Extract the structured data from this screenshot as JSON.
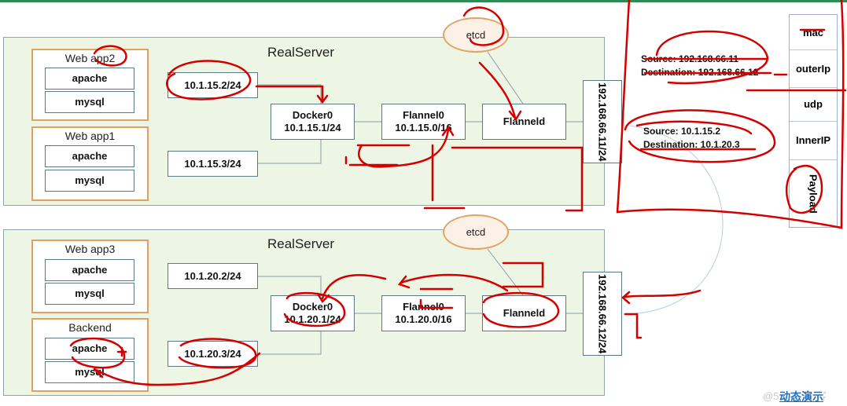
{
  "servers": [
    {
      "title": "RealServer",
      "etcd": "etcd",
      "apps": [
        {
          "title": "Web app2",
          "items": [
            "apache",
            "mysql"
          ]
        },
        {
          "title": "Web app1",
          "items": [
            "apache",
            "mysql"
          ]
        }
      ],
      "container_ips": [
        "10.1.15.2/24",
        "10.1.15.3/24"
      ],
      "docker0": {
        "name": "Docker0",
        "ip": "10.1.15.1/24"
      },
      "flannel0": {
        "name": "Flannel0",
        "ip": "10.1.15.0/16"
      },
      "flanneld": "Flanneld",
      "host_ip": "192.168.66.11/24"
    },
    {
      "title": "RealServer",
      "etcd": "etcd",
      "apps": [
        {
          "title": "Web app3",
          "items": [
            "apache",
            "mysql"
          ]
        },
        {
          "title": "Backend",
          "items": [
            "apache",
            "mysql"
          ]
        }
      ],
      "container_ips": [
        "10.1.20.2/24",
        "10.1.20.3/24"
      ],
      "docker0": {
        "name": "Docker0",
        "ip": "10.1.20.1/24"
      },
      "flannel0": {
        "name": "Flannel0",
        "ip": "10.1.20.0/16"
      },
      "flanneld": "Flanneld",
      "host_ip": "192.168.66.12/24"
    }
  ],
  "outer_header": {
    "source": "Source:  192.168.66.11",
    "destination": "Destination:  192.168.66.12"
  },
  "inner_header": {
    "source": "Source:  10.1.15.2",
    "destination": "Destination:  10.1.20.3"
  },
  "packet": [
    "mac",
    "outerIp",
    "udp",
    "InnerIP",
    "Payload"
  ],
  "footer": {
    "link": "动态演示",
    "watermark": "@51CTO博客"
  },
  "colors": {
    "annotation": "#d40000",
    "server_bg": "#edf5e4",
    "app_border": "#e1a060",
    "top_bar": "#2e8b57"
  }
}
